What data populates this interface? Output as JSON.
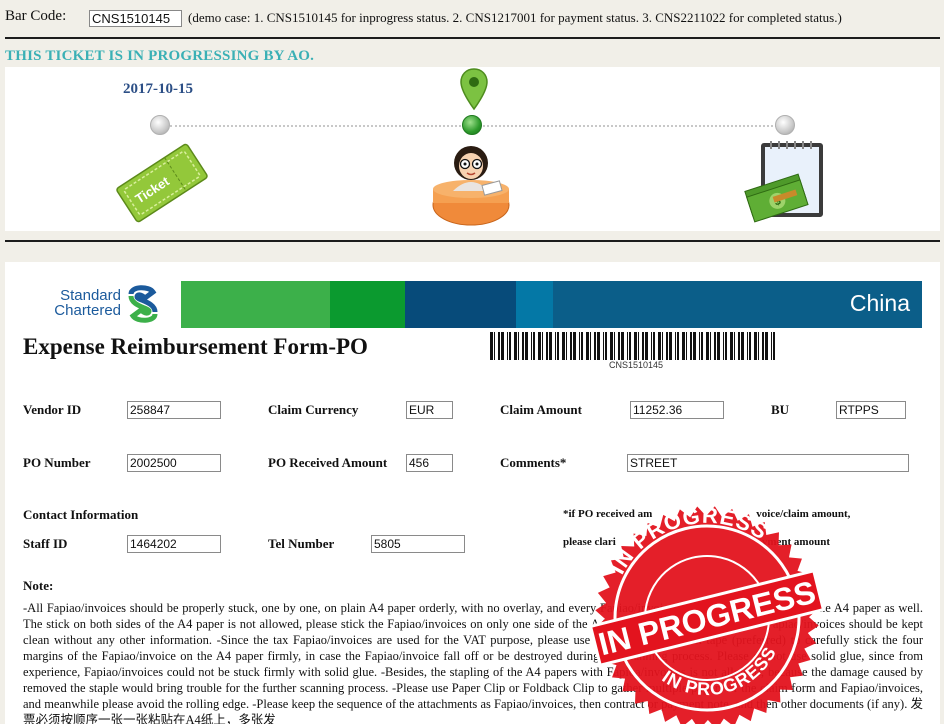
{
  "barcode": {
    "label": "Bar Code:",
    "value": "CNS1510145",
    "demo_text": "(demo case: 1. CNS1510145 for inprogress status. 2. CNS1217001 for payment status. 3. CNS2211022 for completed status.)"
  },
  "status_message": "THIS TICKET IS IN PROGRESSING BY AO.",
  "timeline": {
    "date": "2017-10-15",
    "stages": [
      {
        "icon": "ticket-icon",
        "label": "Ticket",
        "state": "done"
      },
      {
        "icon": "ao-reviewer-icon",
        "state": "current"
      },
      {
        "icon": "payment-money-icon",
        "state": "pending"
      }
    ]
  },
  "brand": {
    "logo_line1": "Standard",
    "logo_line2": "Chartered",
    "country": "China",
    "bar_colors": [
      "#3cb04a",
      "#0b9a2f",
      "#074b7a",
      "#0478a6",
      "#0b5e89"
    ]
  },
  "form": {
    "title": "Expense Reimbursement Form-PO",
    "barcode_caption": "CNS1510145",
    "fields": {
      "vendor_id": {
        "label": "Vendor ID",
        "value": "258847"
      },
      "claim_currency": {
        "label": "Claim Currency",
        "value": "EUR"
      },
      "claim_amount": {
        "label": "Claim Amount",
        "value": "11252.36"
      },
      "bu": {
        "label": "BU",
        "value": "RTPPS"
      },
      "po_number": {
        "label": "PO Number",
        "value": "2002500"
      },
      "po_received_amount": {
        "label": "PO Received Amount",
        "value": "456"
      },
      "comments": {
        "label": "Comments*",
        "value": "STREET"
      },
      "staff_id": {
        "label": "Staff ID",
        "value": "1464202"
      },
      "tel_number": {
        "label": "Tel Number",
        "value": "5805"
      }
    },
    "contact_heading": "Contact Information",
    "hint_line1": "*if PO received am",
    "hint_line1_tail": "voice/claim amount,",
    "hint_line2": "please clari",
    "hint_line2_tail": "yment amount",
    "note_title": "Note:",
    "note_body": "-All Fapiao/invoices should be properly stuck, one by one, on plain A4 paper orderly, with no overlay, and every Fapiao/invoice should be in the middle of the A4 paper as well. The stick on both sides of the A4 paper is not allowed, please stick the Fapiao/invoices on only one side of the A4 paper. -Please do not stick the Fapiao/invoices should be kept clean without any other information. -Since the tax Fapiao/invoices are used for the VAT purpose, please use liquid glue or scotch tape (preferred) to carefully stick the four margins of the Fapiao/invoice on the A4 paper firmly, in case the Fapiao/invoice fall off or be destroyed during the scanning process. Please do not use solid glue, since from experience, Fapiao/invoices could not be stuck firmly with solid glue. -Besides, the stapling of the A4 papers with Fapioa/invoices is not allowed; because the damage caused by removed the staple would bring trouble for the further scanning process. -Please use Paper Clip or Foldback Clip to gather multiple papers of the claim form and Fapiao/invoices, and meanwhile please avoid the rolling edge. -Please keep the sequence of the attachments as Fapiao/invoices, then contract or payment note, and then other documents (if any). 发票必须按顺序一张一张粘贴在A4纸上，多张发"
  },
  "stamp": {
    "top_text": "IN PROGRESS",
    "middle_text": "IN PROGRESS",
    "bottom_text": "IN PROGRESS",
    "color": "#e3131e"
  }
}
